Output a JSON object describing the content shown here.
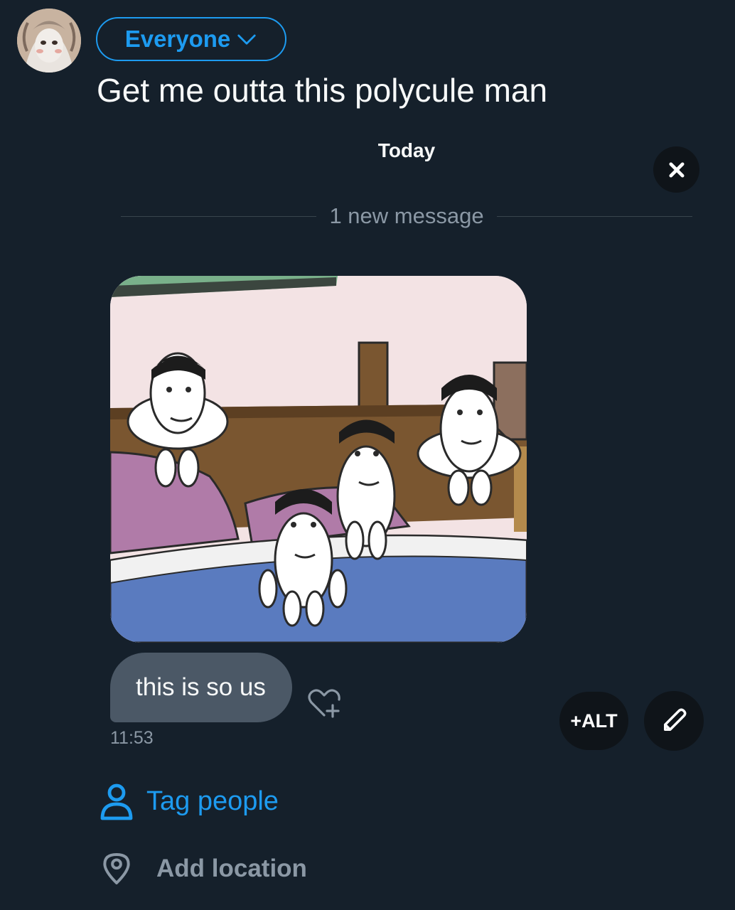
{
  "composer": {
    "audience_label": "Everyone",
    "post_text": "Get me outta this polycule man"
  },
  "conversation": {
    "day_label": "Today",
    "divider_text": "1 new message",
    "message_text": "this is so us",
    "message_time": "11:53"
  },
  "media_actions": {
    "alt_label": "+ALT"
  },
  "options": {
    "tag_label": "Tag people",
    "location_label": "Add location"
  },
  "colors": {
    "background": "#15202b",
    "accent": "#1d9bf0",
    "bubble": "#4b5866",
    "muted": "#8b98a5"
  },
  "icons": [
    "chevron-down-icon",
    "close-icon",
    "heart-plus-icon",
    "pencil-icon",
    "person-icon",
    "location-pin-icon"
  ]
}
